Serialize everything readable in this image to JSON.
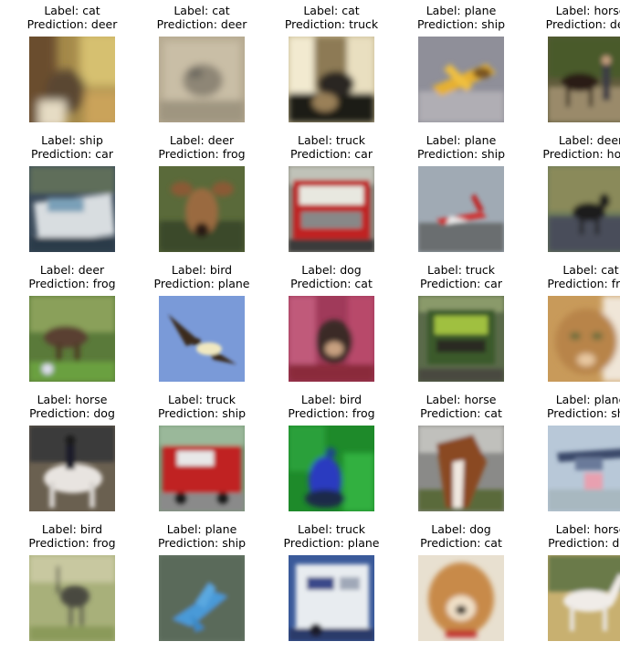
{
  "figure": {
    "label_prefix": "Label: ",
    "prediction_prefix": "Prediction: ",
    "cells": [
      {
        "label": "cat",
        "prediction": "deer",
        "scene": "cat-indoor-warm"
      },
      {
        "label": "cat",
        "prediction": "deer",
        "scene": "cat-pale-box"
      },
      {
        "label": "cat",
        "prediction": "truck",
        "scene": "cat-window"
      },
      {
        "label": "plane",
        "prediction": "ship",
        "scene": "plane-toy-yellow"
      },
      {
        "label": "horse",
        "prediction": "deer",
        "scene": "horse-with-person"
      },
      {
        "label": "ship",
        "prediction": "car",
        "scene": "ship-white-boat"
      },
      {
        "label": "deer",
        "prediction": "frog",
        "scene": "deer-face"
      },
      {
        "label": "truck",
        "prediction": "car",
        "scene": "truck-fire-red"
      },
      {
        "label": "plane",
        "prediction": "ship",
        "scene": "plane-red-tail"
      },
      {
        "label": "deer",
        "prediction": "horse",
        "scene": "deer-road"
      },
      {
        "label": "deer",
        "prediction": "frog",
        "scene": "deer-grass"
      },
      {
        "label": "bird",
        "prediction": "plane",
        "scene": "bird-sky"
      },
      {
        "label": "dog",
        "prediction": "cat",
        "scene": "dog-pink"
      },
      {
        "label": "truck",
        "prediction": "car",
        "scene": "truck-green"
      },
      {
        "label": "cat",
        "prediction": "frog",
        "scene": "cat-closeup-orange"
      },
      {
        "label": "horse",
        "prediction": "dog",
        "scene": "horse-rider-white"
      },
      {
        "label": "truck",
        "prediction": "ship",
        "scene": "truck-fire-red-2"
      },
      {
        "label": "bird",
        "prediction": "frog",
        "scene": "bird-peacock"
      },
      {
        "label": "horse",
        "prediction": "cat",
        "scene": "horse-head-brown"
      },
      {
        "label": "plane",
        "prediction": "ship",
        "scene": "plane-seaplane"
      },
      {
        "label": "bird",
        "prediction": "frog",
        "scene": "bird-ostrich"
      },
      {
        "label": "plane",
        "prediction": "ship",
        "scene": "plane-blue-jet"
      },
      {
        "label": "truck",
        "prediction": "plane",
        "scene": "truck-white-box"
      },
      {
        "label": "dog",
        "prediction": "cat",
        "scene": "dog-face-tan"
      },
      {
        "label": "horse",
        "prediction": "dog",
        "scene": "horse-white-field"
      }
    ]
  }
}
